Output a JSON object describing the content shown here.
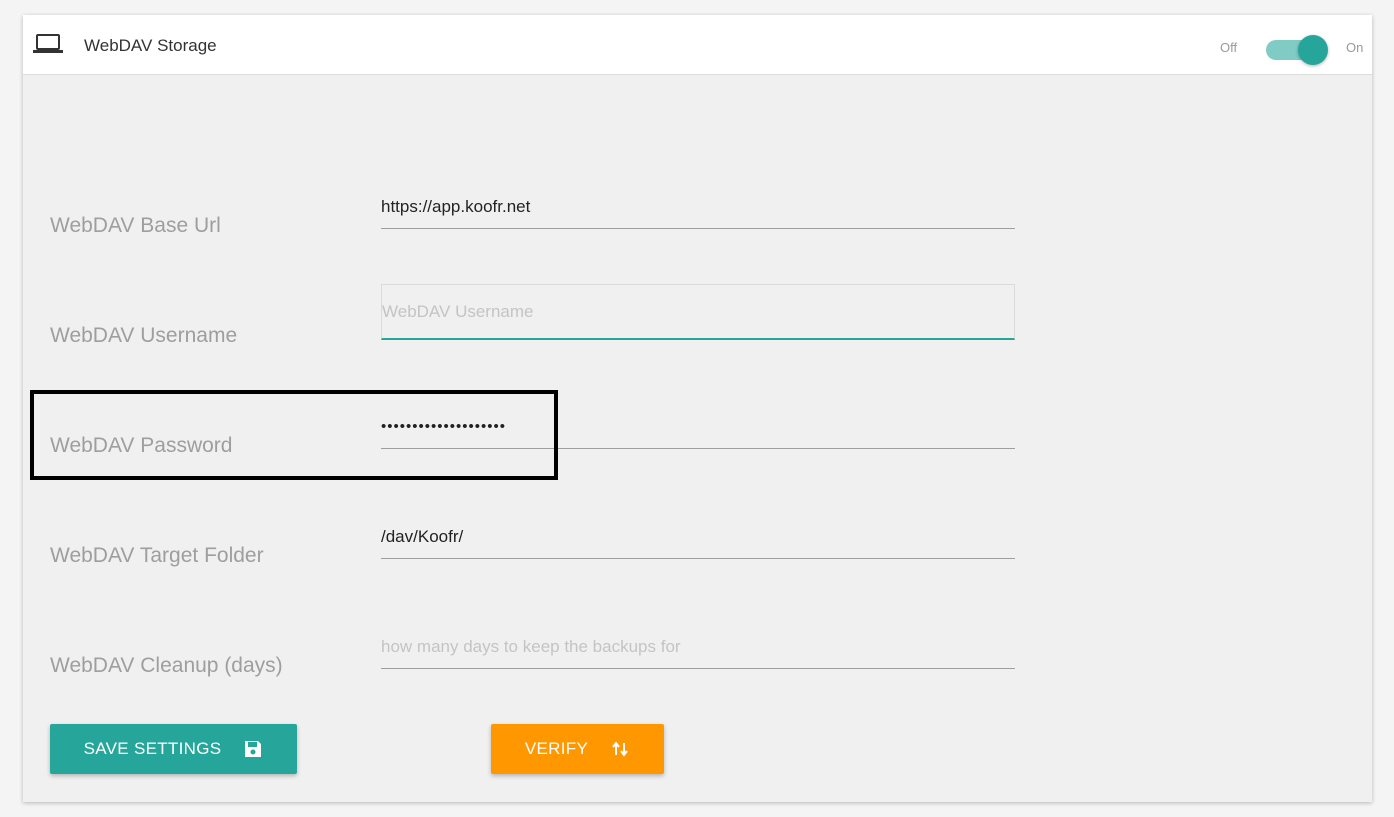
{
  "header": {
    "title": "WebDAV Storage",
    "icon": "laptop-icon",
    "toggle": {
      "off_label": "Off",
      "on_label": "On",
      "state": "on",
      "accent_color": "#26a69a"
    }
  },
  "fields": {
    "base_url": {
      "label": "WebDAV Base Url",
      "value": "https://app.koofr.net",
      "placeholder": ""
    },
    "username": {
      "label": "WebDAV Username",
      "value": "",
      "placeholder": "WebDAV Username"
    },
    "password": {
      "label": "WebDAV Password",
      "value": "••••••••••••••••••••"
    },
    "target_folder": {
      "label": "WebDAV Target Folder",
      "value": "/dav/Koofr/"
    },
    "cleanup": {
      "label": "WebDAV Cleanup (days)",
      "value": "",
      "placeholder": "how many days to keep the backups for"
    }
  },
  "buttons": {
    "save": {
      "label": "SAVE SETTINGS",
      "icon": "floppy-disk-icon",
      "color": "#26a69a"
    },
    "verify": {
      "label": "VERIFY",
      "icon": "swap-vertical-icon",
      "color": "#ff9800"
    }
  }
}
